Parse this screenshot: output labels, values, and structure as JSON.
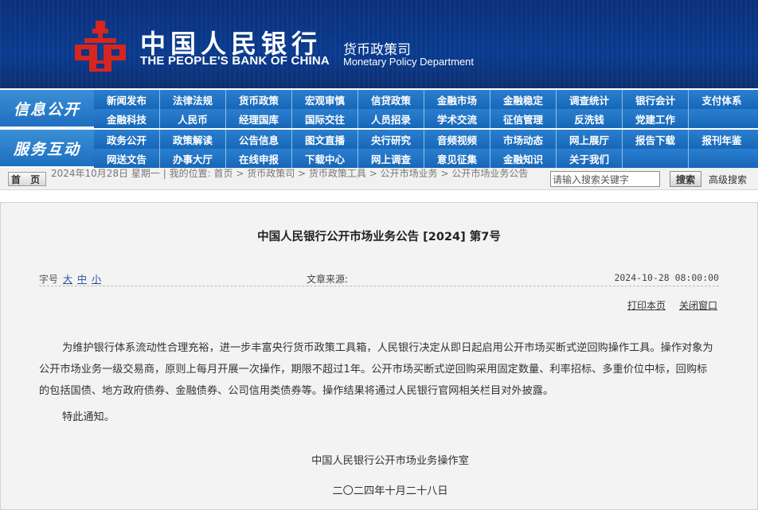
{
  "header": {
    "bank_name_cn": "中国人民银行",
    "bank_name_en": "THE PEOPLE'S BANK OF CHINA",
    "dept_cn": "货币政策司",
    "dept_en": "Monetary Policy Department",
    "bg_color": "#0b3482",
    "logo_color": "#d7251f"
  },
  "nav": {
    "section1_title": "信息公开",
    "section2_title": "服务互动",
    "row1": [
      "新闻发布",
      "法律法规",
      "货币政策",
      "宏观审慎",
      "信贷政策",
      "金融市场",
      "金融稳定",
      "调查统计",
      "银行会计",
      "支付体系"
    ],
    "row2": [
      "金融科技",
      "人民币",
      "经理国库",
      "国际交往",
      "人员招录",
      "学术交流",
      "征信管理",
      "反洗钱",
      "党建工作",
      ""
    ],
    "row3": [
      "政务公开",
      "政策解读",
      "公告信息",
      "图文直播",
      "央行研究",
      "音频视频",
      "市场动态",
      "网上展厅",
      "报告下载",
      "报刊年鉴"
    ],
    "row4": [
      "网送文告",
      "办事大厅",
      "在线申报",
      "下载中心",
      "网上调查",
      "意见征集",
      "金融知识",
      "关于我们",
      "",
      ""
    ]
  },
  "crumbbar": {
    "home_label": "首 页",
    "date_text": "2024年10月28日 星期一",
    "location_label": "我的位置:",
    "crumbs": [
      "首页",
      "货币政策司",
      "货币政策工具",
      "公开市场业务",
      "公开市场业务公告"
    ],
    "search_placeholder": "请输入搜索关键字",
    "search_button": "搜索",
    "advanced_search": "高级搜索"
  },
  "article": {
    "title": "中国人民银行公开市场业务公告 [2024] 第7号",
    "font_size_label": "字号",
    "font_sizes": [
      "大",
      "中",
      "小"
    ],
    "source_label": "文章来源:",
    "publish_time": "2024-10-28 08:00:00",
    "print_label": "打印本页",
    "close_label": "关闭窗口",
    "paragraph1": "为维护银行体系流动性合理充裕，进一步丰富央行货币政策工具箱，人民银行决定从即日起启用公开市场买断式逆回购操作工具。操作对象为公开市场业务一级交易商，原则上每月开展一次操作，期限不超过1年。公开市场买断式逆回购采用固定数量、利率招标、多重价位中标，回购标的包括国债、地方政府债券、金融债券、公司信用类债券等。操作结果将通过人民银行官网相关栏目对外披露。",
    "paragraph2": "特此通知。",
    "signature": "中国人民银行公开市场业务操作室",
    "sign_date": "二〇二四年十月二十八日"
  }
}
